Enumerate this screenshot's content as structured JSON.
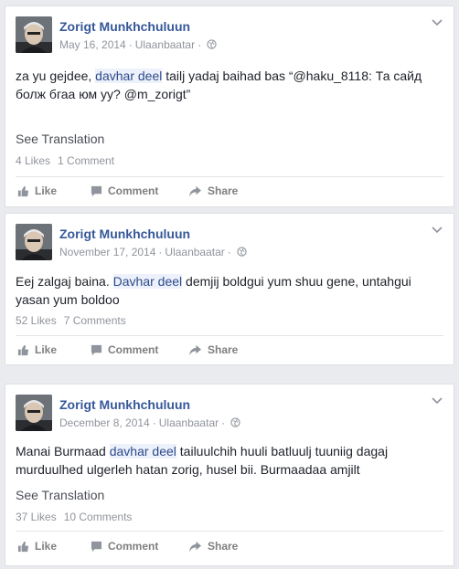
{
  "posts": [
    {
      "author": "Zorigt Munkhchuluun",
      "date": "May 16, 2014",
      "location": "Ulaanbaatar",
      "text_before": "za yu gejdee, ",
      "highlight": "davhar deel",
      "text_after": " tailj yadaj baihad bas “@haku_8118: Та сайд болж бгаа юм уу? @m_zorigt”",
      "see_translation": "See Translation",
      "likes": "4 Likes",
      "comments": "1 Comment"
    },
    {
      "author": "Zorigt Munkhchuluun",
      "date": "November 17, 2014",
      "location": "Ulaanbaatar",
      "text_before": "Eej zalgaj baina. ",
      "highlight": "Davhar deel",
      "text_after": " demjij boldgui yum shuu gene, untahgui yasan yum boldoo",
      "likes": "52 Likes",
      "comments": "7 Comments"
    },
    {
      "author": "Zorigt Munkhchuluun",
      "date": "December 8, 2014",
      "location": "Ulaanbaatar",
      "text_before": "Manai Burmaad ",
      "highlight": "davhar deel",
      "text_after": " tailuulchih huuli batluulj tuuniig dagaj murduulhed ulgerleh hatan zorig, husel bii. Burmaadaa amjilt",
      "see_translation": "See Translation",
      "likes": "37 Likes",
      "comments": "10 Comments"
    }
  ],
  "actions": {
    "like": "Like",
    "comment": "Comment",
    "share": "Share"
  },
  "colors": {
    "link": "#365899",
    "meta": "#90949c",
    "highlight_bg": "#edf1fb"
  }
}
